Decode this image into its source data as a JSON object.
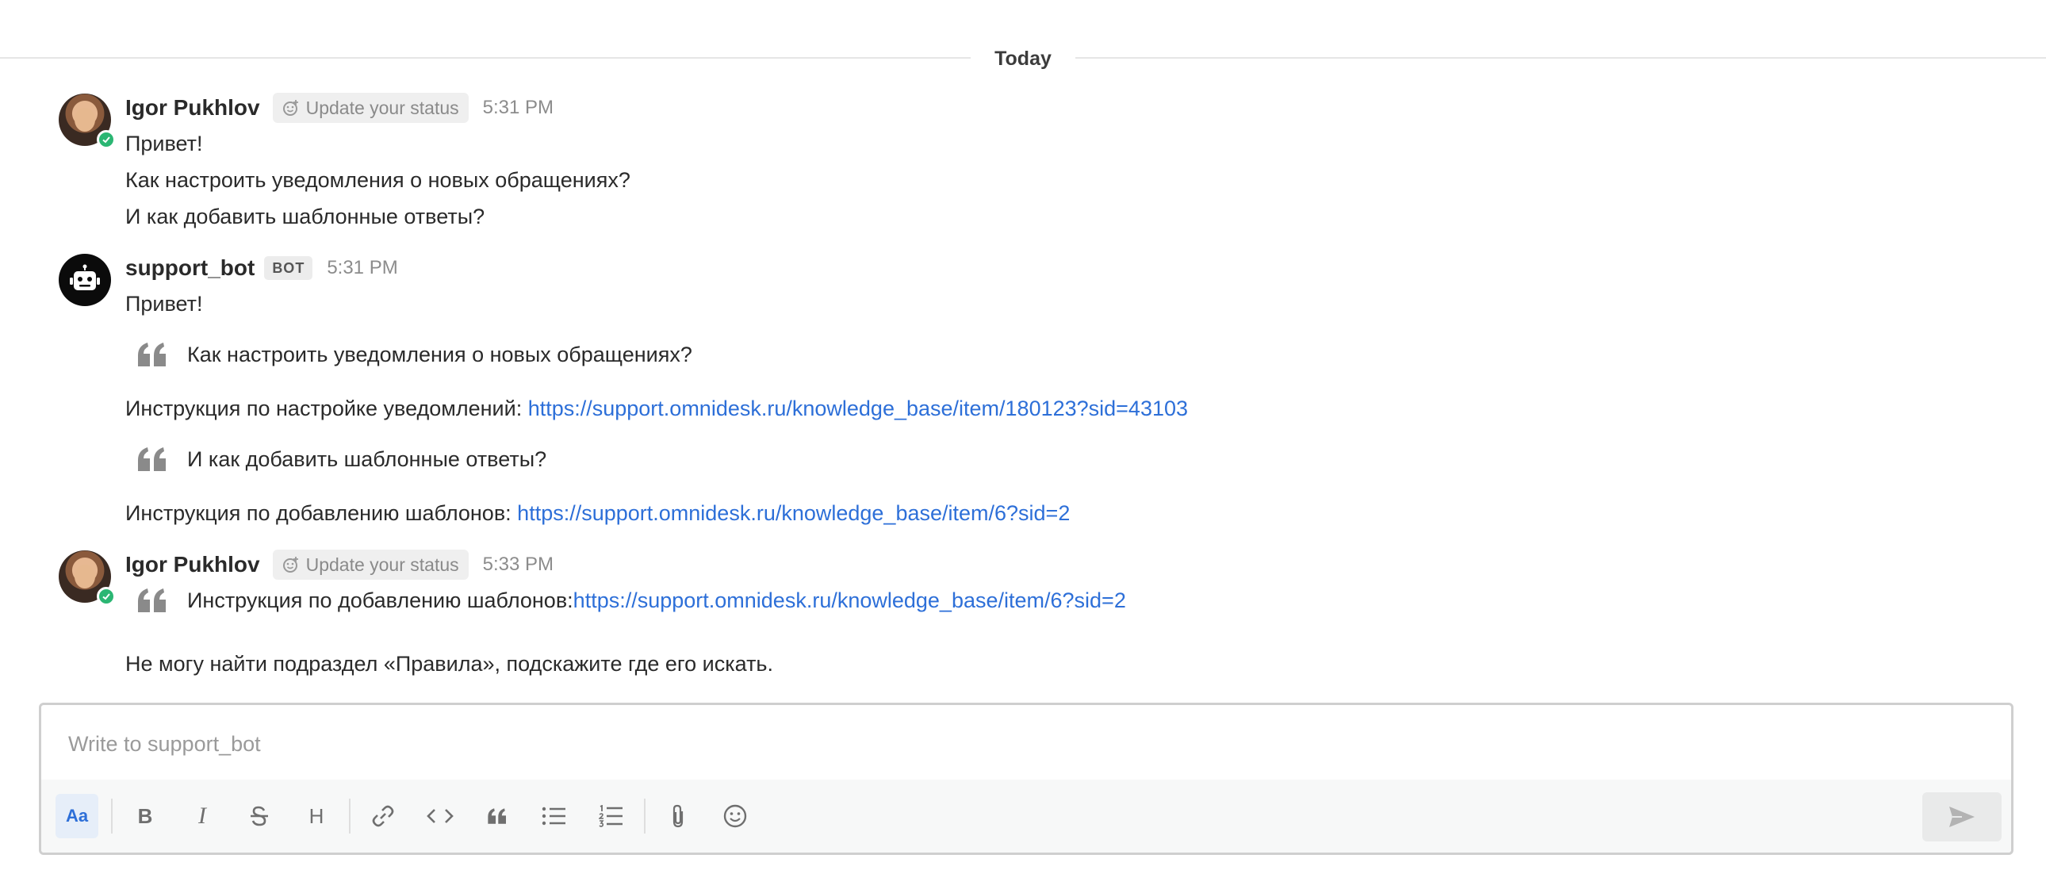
{
  "date_divider": "Today",
  "messages": [
    {
      "author": "Igor Pukhlov",
      "status_chip": "Update your status",
      "time": "5:31 PM",
      "lines": [
        "Привет!",
        "Как настроить уведомления о новых обращениях?",
        "И как добавить шаблонные ответы?"
      ]
    },
    {
      "author": "support_bot",
      "badge": "BOT",
      "time": "5:31 PM",
      "greeting": "Привет!",
      "quote1": "Как настроить уведомления о новых обращениях?",
      "answer1_text": "Инструкция по настройке уведомлений: ",
      "answer1_link": "https://support.omnidesk.ru/knowledge_base/item/180123?sid=43103",
      "quote2": "И как добавить шаблонные ответы?",
      "answer2_text": "Инструкция по добавлению шаблонов: ",
      "answer2_link": "https://support.omnidesk.ru/knowledge_base/item/6?sid=2"
    },
    {
      "author": "Igor Pukhlov",
      "status_chip": "Update your status",
      "time": "5:33 PM",
      "quote_text": "Инструкция по добавлению шаблонов: ",
      "quote_link": "https://support.omnidesk.ru/knowledge_base/item/6?sid=2",
      "line": "Не могу найти подраздел «Правила», подскажите где его искать."
    }
  ],
  "composer": {
    "placeholder": "Write to support_bot",
    "format_toggle_label": "Aa",
    "bold_label": "B",
    "italic_label": "I",
    "heading_label": "H"
  },
  "colors": {
    "link": "#2d6fd8",
    "online": "#2bb673",
    "accent": "#2d6fd8"
  }
}
